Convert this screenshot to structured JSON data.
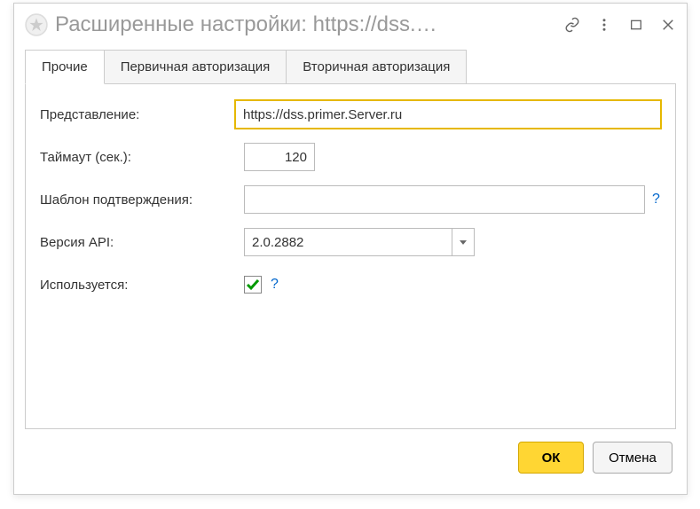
{
  "titlebar": {
    "title": "Расширенные настройки: https://dss.…"
  },
  "tabs": {
    "items": [
      {
        "label": "Прочие",
        "active": true
      },
      {
        "label": "Первичная авторизация",
        "active": false
      },
      {
        "label": "Вторичная авторизация",
        "active": false
      }
    ]
  },
  "form": {
    "representation": {
      "label": "Представление:",
      "value": "https://dss.primer.Server.ru"
    },
    "timeout": {
      "label": "Таймаут (сек.):",
      "value": "120"
    },
    "template": {
      "label": "Шаблон подтверждения:",
      "value": ""
    },
    "api_version": {
      "label": "Версия API:",
      "value": "2.0.2882"
    },
    "used": {
      "label": "Используется:",
      "checked": true
    },
    "help_symbol": "?"
  },
  "footer": {
    "ok_label": "ОК",
    "cancel_label": "Отмена"
  }
}
